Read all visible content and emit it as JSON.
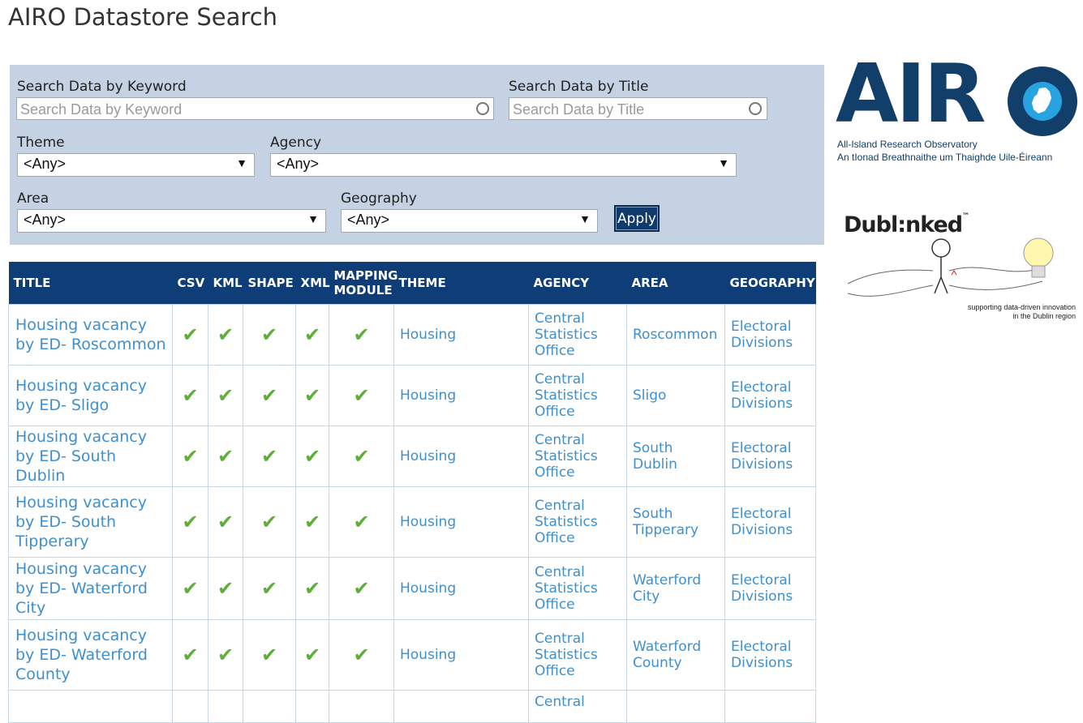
{
  "page": {
    "title": "AIRO Datastore Search"
  },
  "filters": {
    "keyword_label": "Search Data by Keyword",
    "keyword_placeholder": "Search Data by Keyword",
    "title_label": "Search Data by Title",
    "title_placeholder": "Search Data by Title",
    "theme_label": "Theme",
    "theme_value": "<Any>",
    "agency_label": "Agency",
    "agency_value": "<Any>",
    "area_label": "Area",
    "area_value": "<Any>",
    "geography_label": "Geography",
    "geography_value": "<Any>",
    "apply_label": "Apply"
  },
  "table": {
    "headers": [
      "TITLE",
      "CSV",
      "KML",
      "SHAPE",
      "XML",
      "MAPPING MODULE",
      "THEME",
      "AGENCY",
      "AREA",
      "GEOGRAPHY"
    ],
    "rows": [
      {
        "title": "Housing vacancy by ED- Roscommon",
        "csv": "✔",
        "kml": "✔",
        "shape": "✔",
        "xml": "✔",
        "mapping": "✔",
        "theme": "Housing",
        "agency": "Central Statistics Office",
        "area": "Roscommon",
        "geography": "Electoral Divisions"
      },
      {
        "title": "Housing vacancy by ED- Sligo",
        "csv": "✔",
        "kml": "✔",
        "shape": "✔",
        "xml": "✔",
        "mapping": "✔",
        "theme": "Housing",
        "agency": "Central Statistics Office",
        "area": "Sligo",
        "geography": "Electoral Divisions"
      },
      {
        "title": "Housing vacancy by ED- South Dublin",
        "csv": "✔",
        "kml": "✔",
        "shape": "✔",
        "xml": "✔",
        "mapping": "✔",
        "theme": "Housing",
        "agency": "Central Statistics Office",
        "area": "South Dublin",
        "geography": "Electoral Divisions"
      },
      {
        "title": "Housing vacancy by ED- South Tipperary",
        "csv": "✔",
        "kml": "✔",
        "shape": "✔",
        "xml": "✔",
        "mapping": "✔",
        "theme": "Housing",
        "agency": "Central Statistics Office",
        "area": "South Tipperary",
        "geography": "Electoral Divisions"
      },
      {
        "title": "Housing vacancy by ED- Waterford City",
        "csv": "✔",
        "kml": "✔",
        "shape": "✔",
        "xml": "✔",
        "mapping": "✔",
        "theme": "Housing",
        "agency": "Central Statistics Office",
        "area": "Waterford City",
        "geography": "Electoral Divisions"
      },
      {
        "title": "Housing vacancy by ED- Waterford County",
        "csv": "✔",
        "kml": "✔",
        "shape": "✔",
        "xml": "✔",
        "mapping": "✔",
        "theme": "Housing",
        "agency": "Central Statistics Office",
        "area": "Waterford County",
        "geography": "Electoral Divisions"
      },
      {
        "title": "",
        "csv": "",
        "kml": "",
        "shape": "",
        "xml": "",
        "mapping": "",
        "theme": "",
        "agency": "Central",
        "area": "",
        "geography": ""
      }
    ]
  },
  "logos": {
    "airo_word": "AIR",
    "airo_sub1": "All-Island Research Observatory",
    "airo_sub2": "An tIonad Breathnaithe um Thaighde Uile-Éireann",
    "dublinked_word": "Dubl:nked",
    "dublinked_tm": "™",
    "dublinked_tag1": "supporting data-driven innovation",
    "dublinked_tag2": "in the Dublin region"
  },
  "colors": {
    "panel_bg": "#c5d2e3",
    "header_bg": "#0e3d78",
    "link": "#3f8fcf",
    "check": "#5fae3a",
    "airo_navy": "#123e6a",
    "airo_blue": "#29a3e0"
  }
}
